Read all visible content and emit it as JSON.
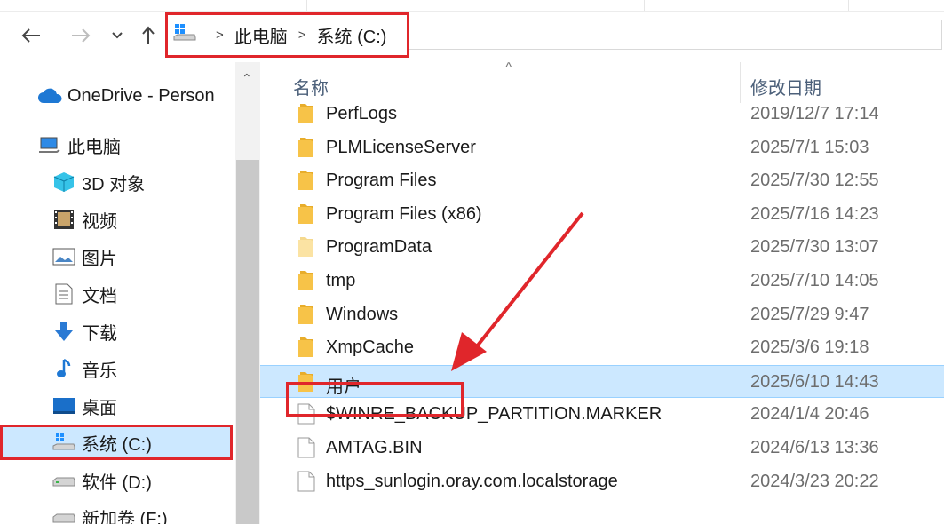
{
  "nav": {
    "back": "←",
    "forward": "→",
    "recent": "⌄",
    "up": "↑"
  },
  "breadcrumb": {
    "items": [
      "此电脑",
      "系统 (C:)"
    ]
  },
  "sidebar": {
    "items": [
      {
        "label": "OneDrive - Person",
        "icon": "cloud-icon"
      },
      {
        "label": "此电脑",
        "icon": "computer-icon"
      },
      {
        "label": "3D 对象",
        "icon": "cube-icon"
      },
      {
        "label": "视频",
        "icon": "film-icon"
      },
      {
        "label": "图片",
        "icon": "picture-icon"
      },
      {
        "label": "文档",
        "icon": "document-icon"
      },
      {
        "label": "下载",
        "icon": "download-icon"
      },
      {
        "label": "音乐",
        "icon": "music-icon"
      },
      {
        "label": "桌面",
        "icon": "desktop-icon"
      },
      {
        "label": "系统 (C:)",
        "icon": "system-drive-icon"
      },
      {
        "label": "软件 (D:)",
        "icon": "drive-icon"
      },
      {
        "label": "新加卷 (F:)",
        "icon": "drive-icon"
      }
    ],
    "selected": "系统 (C:)"
  },
  "list": {
    "header": {
      "name": "名称",
      "date": "修改日期"
    },
    "rows": [
      {
        "name": "PerfLogs",
        "date": "2019/12/7 17:14",
        "type": "folder"
      },
      {
        "name": "PLMLicenseServer",
        "date": "2025/7/1 15:03",
        "type": "folder"
      },
      {
        "name": "Program Files",
        "date": "2025/7/30 12:55",
        "type": "folder"
      },
      {
        "name": "Program Files (x86)",
        "date": "2025/7/16 14:23",
        "type": "folder"
      },
      {
        "name": "ProgramData",
        "date": "2025/7/30 13:07",
        "type": "folder-hidden"
      },
      {
        "name": "tmp",
        "date": "2025/7/10 14:05",
        "type": "folder"
      },
      {
        "name": "Windows",
        "date": "2025/7/29 9:47",
        "type": "folder"
      },
      {
        "name": "XmpCache",
        "date": "2025/3/6 19:18",
        "type": "folder"
      },
      {
        "name": "用户",
        "date": "2025/6/10 14:43",
        "type": "folder"
      },
      {
        "name": "$WINRE_BACKUP_PARTITION.MARKER",
        "date": "2024/1/4 20:46",
        "type": "file"
      },
      {
        "name": "AMTAG.BIN",
        "date": "2024/6/13 13:36",
        "type": "file"
      },
      {
        "name": "https_sunlogin.oray.com.localstorage",
        "date": "2024/3/23 20:22",
        "type": "file"
      }
    ],
    "selected": "用户"
  },
  "colors": {
    "selection": "#cce8ff",
    "highlight": "#e0262b",
    "folder": "#f7c348"
  }
}
